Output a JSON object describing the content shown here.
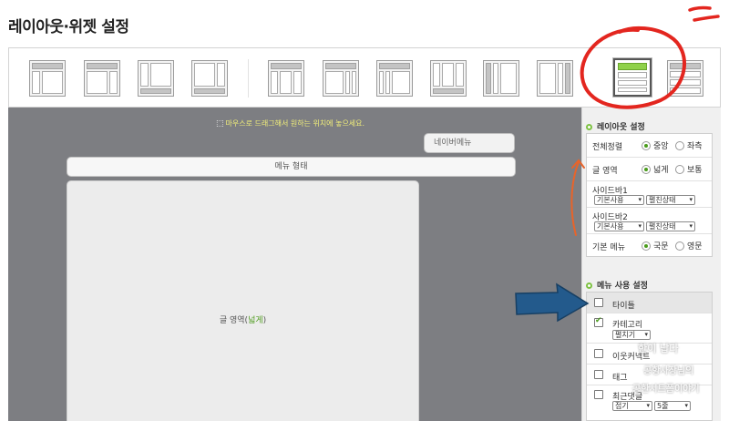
{
  "page": {
    "title": "레이아웃·위젯 설정"
  },
  "canvas": {
    "hint": "마우스로 드래그해서 원하는 위치에 놓으세요.",
    "navbar_menu": "네이버메뉴",
    "menu_bar": "메뉴 형태",
    "content_label": "글 영역",
    "content_label_open": "(",
    "content_label_highlight": "넓게",
    "content_label_close": ")"
  },
  "layout_settings": {
    "title": "레이아웃 설정",
    "align": {
      "label": "전체정렬",
      "options": [
        "중앙",
        "좌측"
      ],
      "selected": "중앙"
    },
    "post_area": {
      "label": "글 영역",
      "options": [
        "넓게",
        "보통"
      ],
      "selected": "넓게"
    },
    "sidebar1": {
      "label": "사이드바1",
      "use": "기본사용",
      "state": "펼친상태"
    },
    "sidebar2": {
      "label": "사이드바2",
      "use": "기본사용",
      "state": "펼친상태"
    },
    "default_menu": {
      "label": "기본 메뉴",
      "options": [
        "국문",
        "영문"
      ],
      "selected": "국문"
    }
  },
  "menu_settings": {
    "title": "메뉴 사용 설정",
    "items": [
      {
        "label": "타이틀",
        "checked": false
      },
      {
        "label": "카테고리",
        "checked": true,
        "select": "펼치기"
      },
      {
        "label": "이웃커넥트",
        "checked": false
      },
      {
        "label": "태그",
        "checked": false
      },
      {
        "label": "최근댓글",
        "checked": false,
        "select": "접기",
        "select2": "5줄"
      }
    ]
  },
  "watermark": {
    "line1": "한이 납다",
    "line2": "공항사장님의",
    "line3": "공한시트폼이야기"
  },
  "colors": {
    "accent_green": "#8fd14a",
    "canvas_bg": "#7d7e82",
    "hint_yellow": "#f3f07a"
  }
}
